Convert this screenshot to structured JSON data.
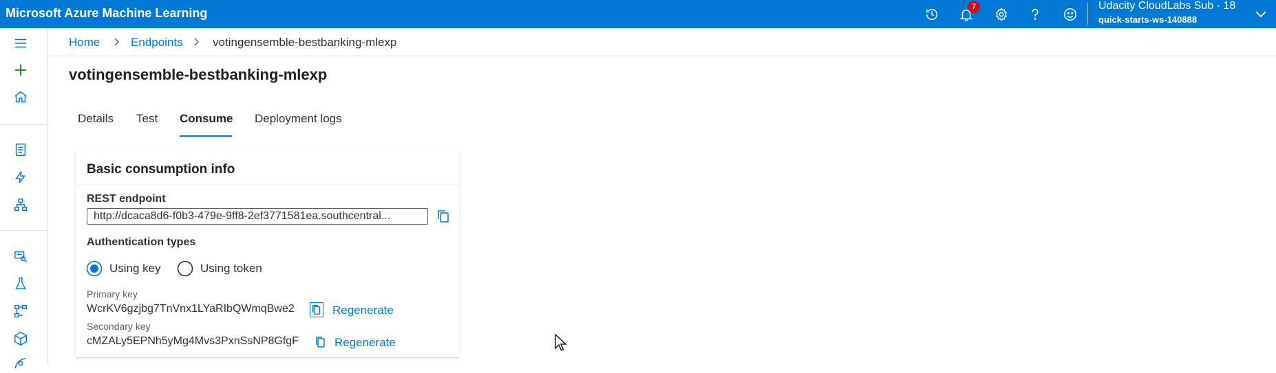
{
  "app": {
    "title": "Microsoft Azure Machine Learning",
    "notifications_count": "7",
    "account_name": "Udacity CloudLabs Sub - 18",
    "workspace": "quick-starts-ws-140888",
    "brand_color": "#0078d4"
  },
  "topbar": {
    "icons": [
      "history-icon",
      "bell-icon",
      "gear-icon",
      "help-icon",
      "feedback-smiley-icon",
      "chevron-down-icon"
    ]
  },
  "leftnav": {
    "icons": [
      "hamburger-menu-icon",
      "plus-new-icon",
      "home-icon",
      "notebook-icon",
      "automl-icon",
      "designer-icon",
      "datasets-icon",
      "experiments-icon",
      "pipelines-icon",
      "models-icon",
      "endpoints-icon"
    ]
  },
  "breadcrumb": {
    "home": "Home",
    "endpoints": "Endpoints",
    "current": "votingensemble-bestbanking-mlexp"
  },
  "page": {
    "title": "votingensemble-bestbanking-mlexp"
  },
  "tabs": [
    {
      "label": "Details",
      "active": false
    },
    {
      "label": "Test",
      "active": false
    },
    {
      "label": "Consume",
      "active": true
    },
    {
      "label": "Deployment logs",
      "active": false
    }
  ],
  "card": {
    "title": "Basic consumption info",
    "rest_label": "REST endpoint",
    "rest_value": "http://dcaca8d6-f0b3-479e-9ff8-2ef3771581ea.southcentral...",
    "auth_label": "Authentication types",
    "auth_options": [
      {
        "label": "Using key",
        "selected": true
      },
      {
        "label": "Using token",
        "selected": false
      }
    ],
    "primary_key_label": "Primary key",
    "primary_key_value": "WcrKV6gzjbg7TnVnx1LYaRIbQWmqBwe2",
    "secondary_key_label": "Secondary key",
    "secondary_key_value": "cMZALy5EPNh5yMg4Mvs3PxnSsNP8GfgF",
    "regenerate_label": "Regenerate"
  }
}
